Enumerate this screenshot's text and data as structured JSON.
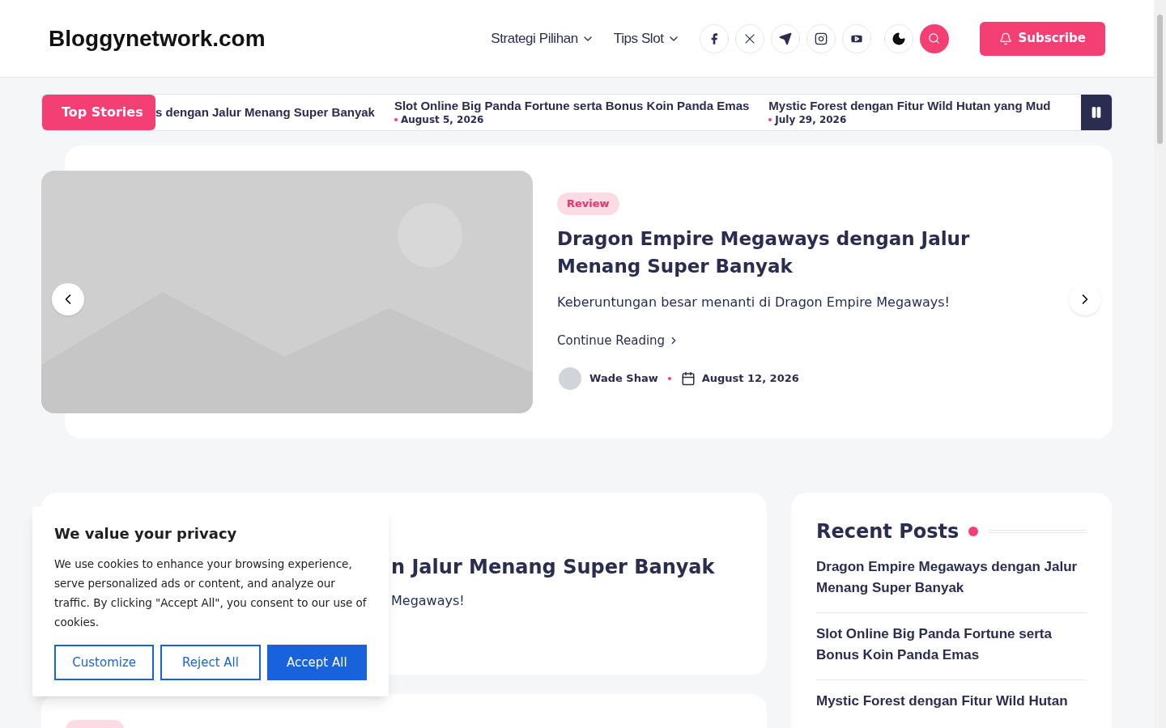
{
  "site_title": "Bloggynetwork.com",
  "nav": [
    {
      "label": "Strategi Pilihan"
    },
    {
      "label": "Tips Slot"
    }
  ],
  "social": [
    {
      "kind": "facebook"
    },
    {
      "kind": "x"
    },
    {
      "kind": "telegram"
    },
    {
      "kind": "instagram"
    },
    {
      "kind": "youtube"
    }
  ],
  "dark_mode": false,
  "subscribe": "Subscribe",
  "ticker": {
    "label": "Top Stories",
    "paused": false,
    "items": [
      {
        "title": "s dengan Jalur Menang Super Banyak"
      },
      {
        "title": "Slot Online Big Panda Fortune serta Bonus Koin Panda Emas",
        "date": "August 5, 2026"
      },
      {
        "title": "Mystic Forest dengan Fitur Wild Hutan yang Mud",
        "date": "July 29, 2026"
      }
    ]
  },
  "featured": {
    "category": "Review",
    "title": "Dragon Empire Megaways dengan Jalur Menang Super Banyak",
    "excerpt": "Keberuntungan besar menanti di Dragon Empire Megaways!",
    "more": "Continue Reading",
    "author": "Wade Shaw",
    "date": "August 12, 2026"
  },
  "post_card": {
    "title": "n Jalur Menang Super Banyak",
    "excerpt": "Megaways!"
  },
  "recent_posts": {
    "title": "Recent Posts",
    "items": [
      {
        "title": "Dragon Empire Megaways dengan Jalur Menang Super Banyak"
      },
      {
        "title": "Slot Online Big Panda Fortune serta Bonus Koin Panda Emas"
      },
      {
        "title": "Mystic Forest dengan Fitur Wild Hutan"
      }
    ]
  },
  "cookie": {
    "title": "We value your privacy",
    "text": "We use cookies to enhance your browsing experience, serve personalized ads or content, and analyze our traffic. By clicking \"Accept All\", you consent to our use of cookies.",
    "buttons": [
      {
        "label": "Customize",
        "kind": "outline"
      },
      {
        "label": "Reject All",
        "kind": "outline"
      },
      {
        "label": "Accept All",
        "kind": "primary"
      }
    ]
  }
}
